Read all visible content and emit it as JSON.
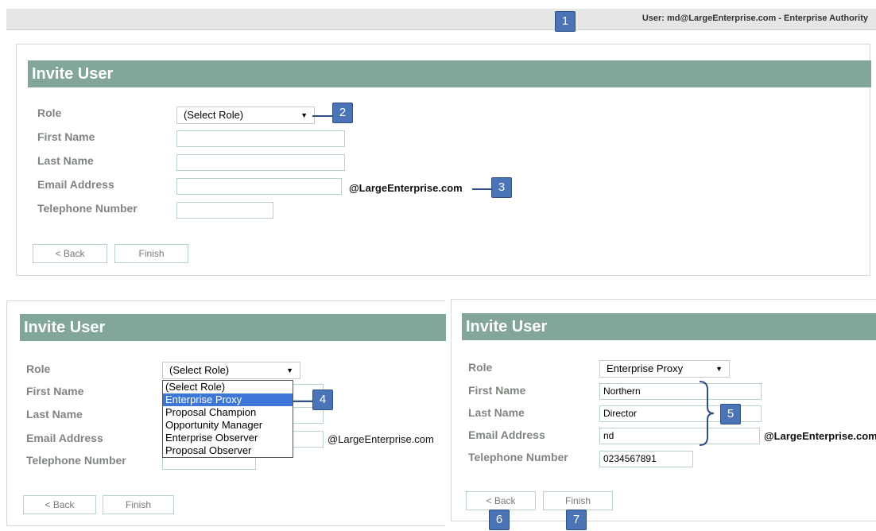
{
  "user_bar": {
    "text": "User: md@LargeEnterprise.com - Enterprise Authority"
  },
  "callouts": [
    "1",
    "2",
    "3",
    "4",
    "5",
    "6",
    "7"
  ],
  "panel1": {
    "title": "Invite User",
    "labels": {
      "role": "Role",
      "first": "First Name",
      "last": "Last Name",
      "email": "Email Address",
      "phone": "Telephone Number"
    },
    "role_value": "(Select Role)",
    "first_value": "",
    "last_value": "",
    "email_value": "",
    "email_domain": "@LargeEnterprise.com",
    "phone_value": "",
    "back_label": "< Back",
    "finish_label": "Finish"
  },
  "panel2": {
    "title": "Invite User",
    "labels": {
      "role": "Role",
      "first": "First Name",
      "last": "Last Name",
      "email": "Email Address",
      "phone": "Telephone Number"
    },
    "role_value": "(Select Role)",
    "role_options": [
      "(Select Role)",
      "Enterprise Proxy",
      "Proposal Champion",
      "Opportunity Manager",
      "Enterprise Observer",
      "Proposal Observer"
    ],
    "highlighted_option": "Enterprise Proxy",
    "email_domain": "@LargeEnterprise.com",
    "back_label": "< Back",
    "finish_label": "Finish"
  },
  "panel3": {
    "title": "Invite User",
    "labels": {
      "role": "Role",
      "first": "First Name",
      "last": "Last Name",
      "email": "Email Address",
      "phone": "Telephone Number"
    },
    "role_value": "Enterprise Proxy",
    "first_value": "Northern",
    "last_value": "Director",
    "email_value": "nd",
    "email_domain": "@LargeEnterprise.com",
    "phone_value": "0234567891",
    "back_label": "< Back",
    "finish_label": "Finish"
  },
  "colors": {
    "header": "#82a79a",
    "callout": "#4a74b6",
    "highlight": "#3d78d8",
    "label": "#7f857f"
  }
}
